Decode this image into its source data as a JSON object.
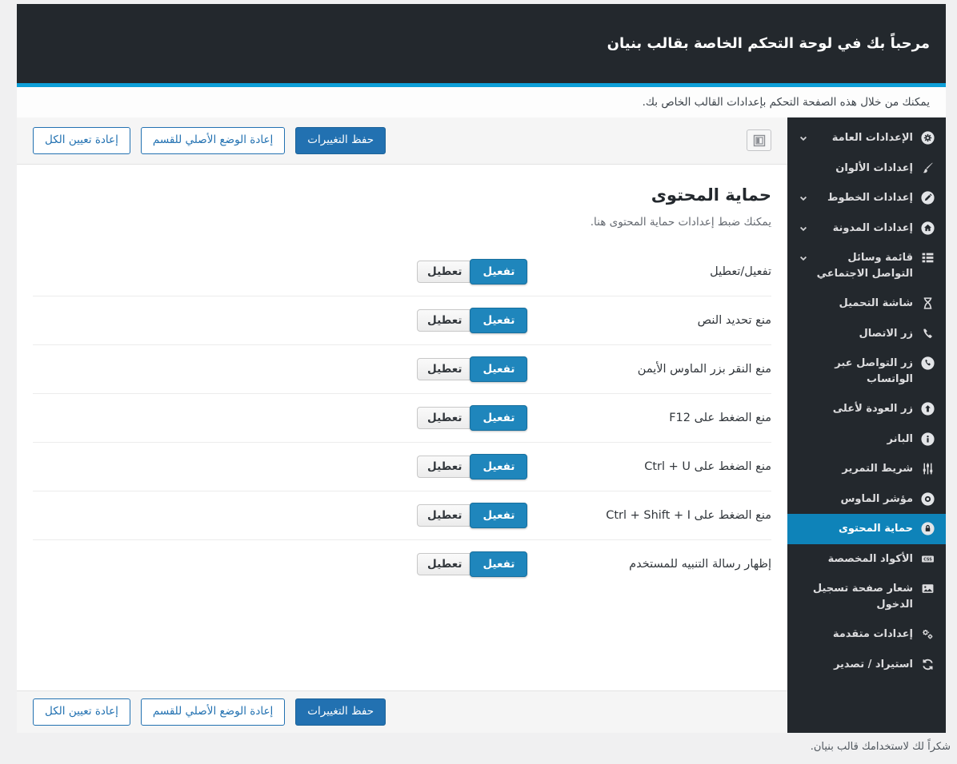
{
  "colors": {
    "header_bg": "#23282d",
    "accent_line": "#0d9fd8",
    "primary_button": "#2271b1",
    "toggle_on": "#1f86bc",
    "sidebar_active": "#0e83b9"
  },
  "header": {
    "title": "مرحباً بك في لوحة التحكم الخاصة بقالب بنيان"
  },
  "intro": {
    "text": "يمكنك من خلال هذه الصفحة التحكم بإعدادات القالب الخاص بك."
  },
  "toolbar": {
    "save": "حفظ التغييرات",
    "reset_section": "إعادة الوضع الأصلي للقسم",
    "reset_all": "إعادة تعيين الكل"
  },
  "sidebar": {
    "items": [
      {
        "label": "الإعدادات العامة",
        "icon": "gear-icon",
        "chevron": true,
        "active": false
      },
      {
        "label": "إعدادات الألوان",
        "icon": "brush-icon",
        "chevron": false,
        "active": false
      },
      {
        "label": "إعدادات الخطوط",
        "icon": "pencil-icon",
        "chevron": true,
        "active": false
      },
      {
        "label": "إعدادات المدونة",
        "icon": "home-icon",
        "chevron": true,
        "active": false
      },
      {
        "label": "قائمة وسائل التواصل الاجتماعي",
        "icon": "list-icon",
        "chevron": true,
        "active": false
      },
      {
        "label": "شاشة التحميل",
        "icon": "hourglass-icon",
        "chevron": false,
        "active": false
      },
      {
        "label": "زر الاتصال",
        "icon": "phone-icon",
        "chevron": false,
        "active": false
      },
      {
        "label": "زر التواصل عبر الواتساب",
        "icon": "whatsapp-icon",
        "chevron": false,
        "active": false
      },
      {
        "label": "زر العودة لأعلى",
        "icon": "arrow-up-circle-icon",
        "chevron": false,
        "active": false
      },
      {
        "label": "البانر",
        "icon": "info-icon",
        "chevron": false,
        "active": false
      },
      {
        "label": "شريط التمرير",
        "icon": "sliders-icon",
        "chevron": false,
        "active": false
      },
      {
        "label": "مؤشر الماوس",
        "icon": "cursor-icon",
        "chevron": false,
        "active": false
      },
      {
        "label": "حماية المحتوى",
        "icon": "lock-icon",
        "chevron": false,
        "active": true
      },
      {
        "label": "الأكواد المخصصة",
        "icon": "css-icon",
        "chevron": false,
        "active": false
      },
      {
        "label": "شعار صفحة تسجيل الدخول",
        "icon": "image-icon",
        "chevron": false,
        "active": false
      },
      {
        "label": "إعدادات متقدمة",
        "icon": "gears-icon",
        "chevron": false,
        "active": false
      },
      {
        "label": "استيراد / تصدير",
        "icon": "sync-icon",
        "chevron": false,
        "active": false
      }
    ]
  },
  "section": {
    "title": "حماية المحتوى",
    "description": "يمكنك ضبط إعدادات حماية المحتوى هنا.",
    "toggle_on": "تفعيل",
    "toggle_off": "تعطيل",
    "rows": [
      {
        "label": "تفعيل/تعطيل"
      },
      {
        "label": "منع تحديد النص"
      },
      {
        "label": "منع النقر بزر الماوس الأيمن"
      },
      {
        "label": "منع الضغط على F12"
      },
      {
        "label": "منع الضغط على Ctrl + U"
      },
      {
        "label": "منع الضغط على Ctrl + Shift + I"
      },
      {
        "label": "إظهار رسالة التنبيه للمستخدم"
      }
    ]
  },
  "footer": {
    "text": "شكراً لك لاستخدامك قالب بنيان."
  }
}
